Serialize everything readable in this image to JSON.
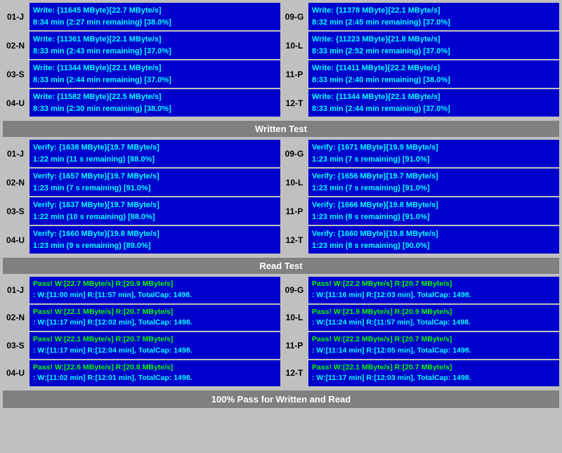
{
  "writeSection": {
    "rows": [
      {
        "left": {
          "id": "01-J",
          "line1": "Write: {11645 MByte}[22.7 MByte/s]",
          "line2": "8:34 min (2:27 min remaining)  [38.0%]"
        },
        "right": {
          "id": "09-G",
          "line1": "Write: {11378 MByte}[22.1 MByte/s]",
          "line2": "8:32 min (2:45 min remaining)  [37.0%]"
        }
      },
      {
        "left": {
          "id": "02-N",
          "line1": "Write: {11361 MByte}[22.1 MByte/s]",
          "line2": "8:33 min (2:43 min remaining)  [37.0%]"
        },
        "right": {
          "id": "10-L",
          "line1": "Write: {11223 MByte}[21.8 MByte/s]",
          "line2": "8:33 min (2:52 min remaining)  [37.0%]"
        }
      },
      {
        "left": {
          "id": "03-S",
          "line1": "Write: {11344 MByte}[22.1 MByte/s]",
          "line2": "8:33 min (2:44 min remaining)  [37.0%]"
        },
        "right": {
          "id": "11-P",
          "line1": "Write: {11411 MByte}[22.2 MByte/s]",
          "line2": "8:33 min (2:40 min remaining)  [38.0%]"
        }
      },
      {
        "left": {
          "id": "04-U",
          "line1": "Write: {11582 MByte}[22.5 MByte/s]",
          "line2": "8:33 min (2:30 min remaining)  [38.0%]"
        },
        "right": {
          "id": "12-T",
          "line1": "Write: {11344 MByte}[22.1 MByte/s]",
          "line2": "8:33 min (2:44 min remaining)  [37.0%]"
        }
      }
    ],
    "header": "Written Test"
  },
  "verifySection": {
    "rows": [
      {
        "left": {
          "id": "01-J",
          "line1": "Verify: {1638 MByte}[19.7 MByte/s]",
          "line2": "1:22 min (11 s remaining)   [88.0%]"
        },
        "right": {
          "id": "09-G",
          "line1": "Verify: {1671 MByte}[19.9 MByte/s]",
          "line2": "1:23 min (7 s remaining)   [91.0%]"
        }
      },
      {
        "left": {
          "id": "02-N",
          "line1": "Verify: {1657 MByte}[19.7 MByte/s]",
          "line2": "1:23 min (7 s remaining)   [91.0%]"
        },
        "right": {
          "id": "10-L",
          "line1": "Verify: {1656 MByte}[19.7 MByte/s]",
          "line2": "1:23 min (7 s remaining)   [91.0%]"
        }
      },
      {
        "left": {
          "id": "03-S",
          "line1": "Verify: {1637 MByte}[19.7 MByte/s]",
          "line2": "1:22 min (10 s remaining)   [88.0%]"
        },
        "right": {
          "id": "11-P",
          "line1": "Verify: {1666 MByte}[19.8 MByte/s]",
          "line2": "1:23 min (8 s remaining)   [91.0%]"
        }
      },
      {
        "left": {
          "id": "04-U",
          "line1": "Verify: {1660 MByte}[19.8 MByte/s]",
          "line2": "1:23 min (9 s remaining)   [89.0%]"
        },
        "right": {
          "id": "12-T",
          "line1": "Verify: {1660 MByte}[19.8 MByte/s]",
          "line2": "1:23 min (8 s remaining)   [90.0%]"
        }
      }
    ],
    "header": "Read Test"
  },
  "passSection": {
    "rows": [
      {
        "left": {
          "id": "01-J",
          "line1": "Pass! W:[22.7 MByte/s] R:[20.9 MByte/s]",
          "line2": ": W:[11:00 min] R:[11:57 min], TotalCap: 1498."
        },
        "right": {
          "id": "09-G",
          "line1": "Pass! W:[22.2 MByte/s] R:[20.7 MByte/s]",
          "line2": ": W:[11:16 min] R:[12:03 min], TotalCap: 1498."
        }
      },
      {
        "left": {
          "id": "02-N",
          "line1": "Pass! W:[22.1 MByte/s] R:[20.7 MByte/s]",
          "line2": ": W:[11:17 min] R:[12:02 min], TotalCap: 1498."
        },
        "right": {
          "id": "10-L",
          "line1": "Pass! W:[21.9 MByte/s] R:[20.9 MByte/s]",
          "line2": ": W:[11:24 min] R:[11:57 min], TotalCap: 1498."
        }
      },
      {
        "left": {
          "id": "03-S",
          "line1": "Pass! W:[22.1 MByte/s] R:[20.7 MByte/s]",
          "line2": ": W:[11:17 min] R:[12:04 min], TotalCap: 1498."
        },
        "right": {
          "id": "11-P",
          "line1": "Pass! W:[22.2 MByte/s] R:[20.7 MByte/s]",
          "line2": ": W:[11:14 min] R:[12:05 min], TotalCap: 1498."
        }
      },
      {
        "left": {
          "id": "04-U",
          "line1": "Pass! W:[22.6 MByte/s] R:[20.8 MByte/s]",
          "line2": ": W:[11:02 min] R:[12:01 min], TotalCap: 1498."
        },
        "right": {
          "id": "12-T",
          "line1": "Pass! W:[22.1 MByte/s] R:[20.7 MByte/s]",
          "line2": ": W:[11:17 min] R:[12:03 min], TotalCap: 1498."
        }
      }
    ]
  },
  "footer": "100% Pass for Written and Read"
}
